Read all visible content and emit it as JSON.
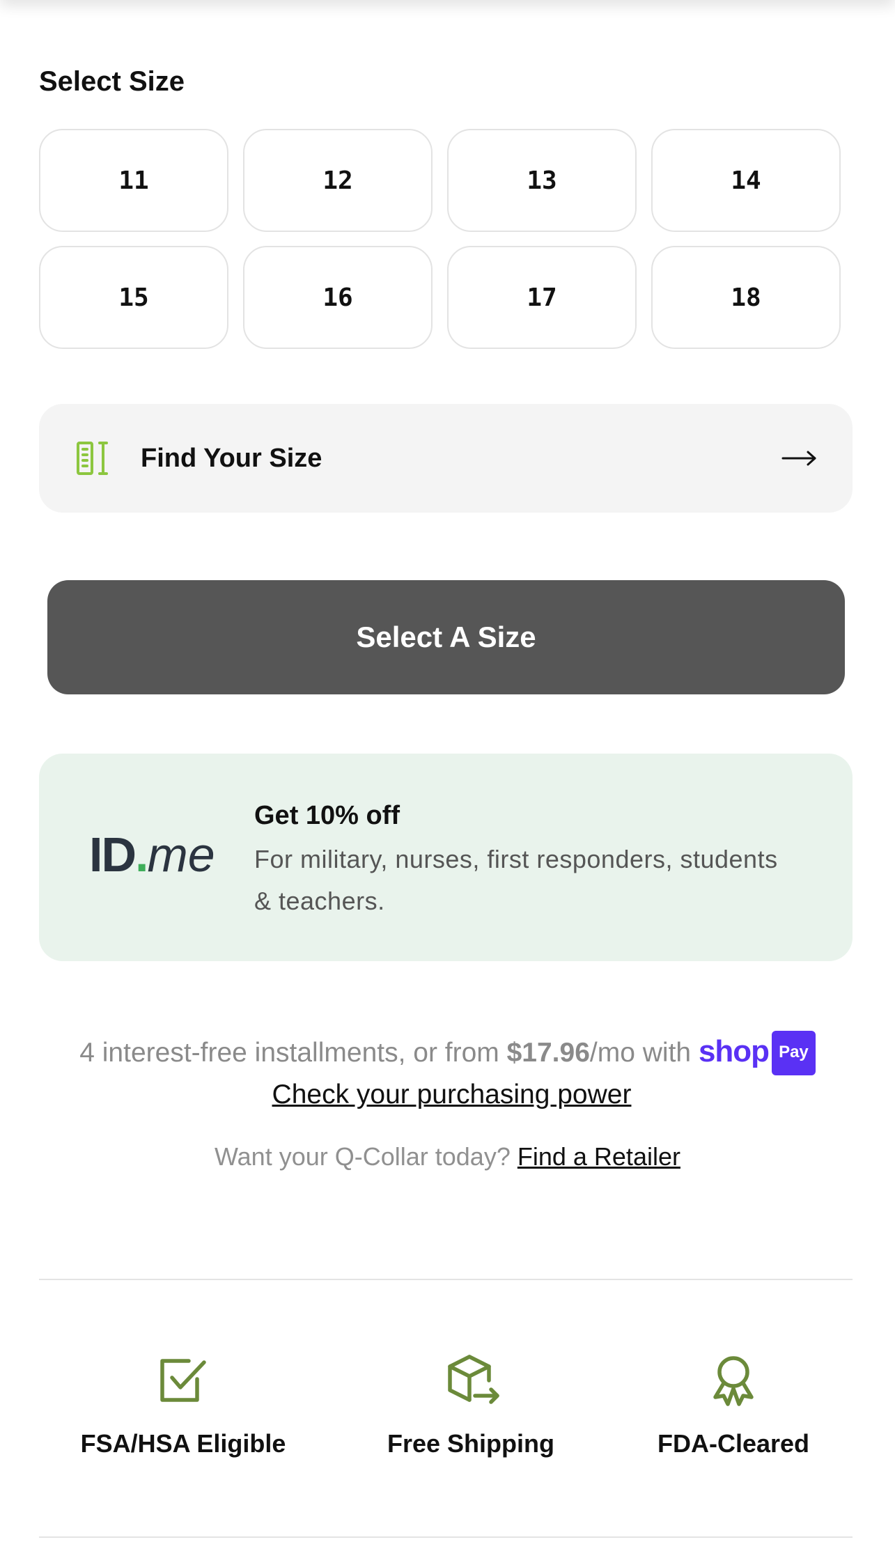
{
  "size_selector": {
    "title": "Select Size",
    "sizes": [
      "11",
      "12",
      "13",
      "14",
      "15",
      "16",
      "17",
      "18"
    ]
  },
  "find_size": {
    "label": "Find Your Size",
    "icon": "ruler-icon",
    "arrow_icon": "arrow-right-icon"
  },
  "cta": {
    "label": "Select A Size"
  },
  "idme": {
    "logo_id": "ID",
    "logo_dot": ".",
    "logo_me": "me",
    "title": "Get 10% off",
    "text": "For military, nurses, first responders, students & teachers."
  },
  "installments": {
    "prefix": "4 interest-free installments, or from ",
    "price": "$17.96",
    "suffix": "/mo with ",
    "shop_logo": "shop",
    "pay_badge": "Pay",
    "link": "Check your purchasing power"
  },
  "retailer": {
    "prompt": "Want your Q-Collar today? ",
    "link": "Find a Retailer"
  },
  "features": [
    {
      "icon": "checkbox-icon",
      "label": "FSA/HSA Eligible"
    },
    {
      "icon": "box-shipping-icon",
      "label": "Free Shipping"
    },
    {
      "icon": "award-ribbon-icon",
      "label": "FDA-Cleared"
    }
  ],
  "colors": {
    "accent_green": "#6b8a3a",
    "ruler_green": "#8cc63f",
    "cta_bg": "#565656",
    "idme_bg": "#e9f3ec",
    "shop_purple": "#5a31f4"
  }
}
